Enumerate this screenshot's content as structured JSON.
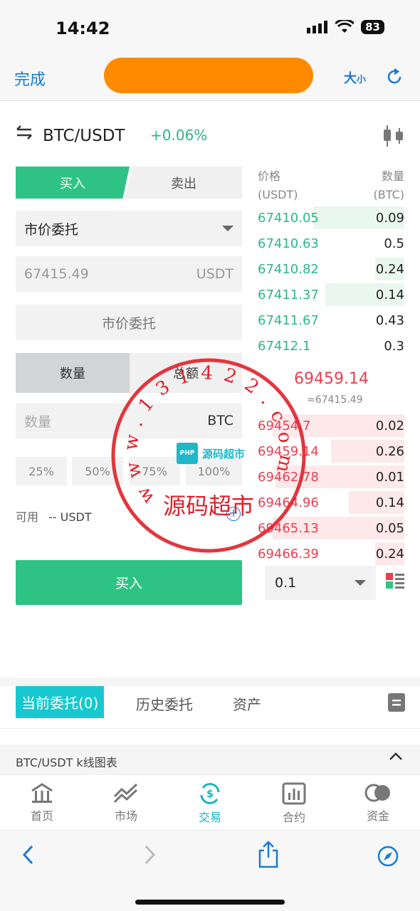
{
  "status_bar": {
    "time": "14:42",
    "battery": "83"
  },
  "browser": {
    "done": "完成",
    "text_size_big": "大",
    "text_size_small": "小"
  },
  "pair": {
    "name": "BTC/USDT",
    "change": "+0.06%"
  },
  "trade_form": {
    "buy_tab": "买入",
    "sell_tab": "卖出",
    "order_type": "市价委托",
    "price_value": "67415.49",
    "price_unit": "USDT",
    "market_button": "市价委托",
    "qty_tab": "数量",
    "total_tab": "总额",
    "amount_placeholder": "数量",
    "amount_unit": "BTC",
    "percents": [
      "25%",
      "50%",
      "75%",
      "100%"
    ],
    "available_label": "可用",
    "available_value": "-- USDT",
    "buy_button": "买入"
  },
  "orderbook": {
    "price_header": "价格",
    "price_unit": "(USDT)",
    "qty_header": "数量",
    "qty_unit": "(BTC)",
    "bids": [
      {
        "price": "67410.05",
        "qty": "0.09",
        "depth": 0.62
      },
      {
        "price": "67410.63",
        "qty": "0.5",
        "depth": 0.0
      },
      {
        "price": "67410.82",
        "qty": "0.24",
        "depth": 0.2
      },
      {
        "price": "67411.37",
        "qty": "0.14",
        "depth": 0.54
      },
      {
        "price": "67411.67",
        "qty": "0.43",
        "depth": 0.0
      },
      {
        "price": "67412.1",
        "qty": "0.3",
        "depth": 0.0
      }
    ],
    "last_price": "69459.14",
    "approx_price": "≈67415.49",
    "asks": [
      {
        "price": "69454.7",
        "qty": "0.02",
        "depth": 0.9
      },
      {
        "price": "69459.14",
        "qty": "0.26",
        "depth": 0.5
      },
      {
        "price": "69462.78",
        "qty": "0.01",
        "depth": 0.88
      },
      {
        "price": "69464.96",
        "qty": "0.14",
        "depth": 0.38
      },
      {
        "price": "69465.13",
        "qty": "0.05",
        "depth": 0.9
      },
      {
        "price": "69466.39",
        "qty": "0.24",
        "depth": 0.2
      }
    ],
    "depth_value": "0.1"
  },
  "bottom_tabs": {
    "current": "当前委托(0)",
    "history": "历史委托",
    "assets": "资产"
  },
  "kline": {
    "label": "BTC/USDT k线图表"
  },
  "nav": [
    "首页",
    "市场",
    "交易",
    "合约",
    "资金"
  ],
  "watermark": {
    "stamp_text": "源码超市",
    "stamp_url": "www.131422.com",
    "logo_badge": "PHP",
    "logo_text": "源码超市"
  },
  "colors": {
    "buy_green": "#2ec384",
    "sell_red": "#e8404f",
    "accent_blue": "#1a7bd1",
    "active_tab": "#18c8d0"
  }
}
